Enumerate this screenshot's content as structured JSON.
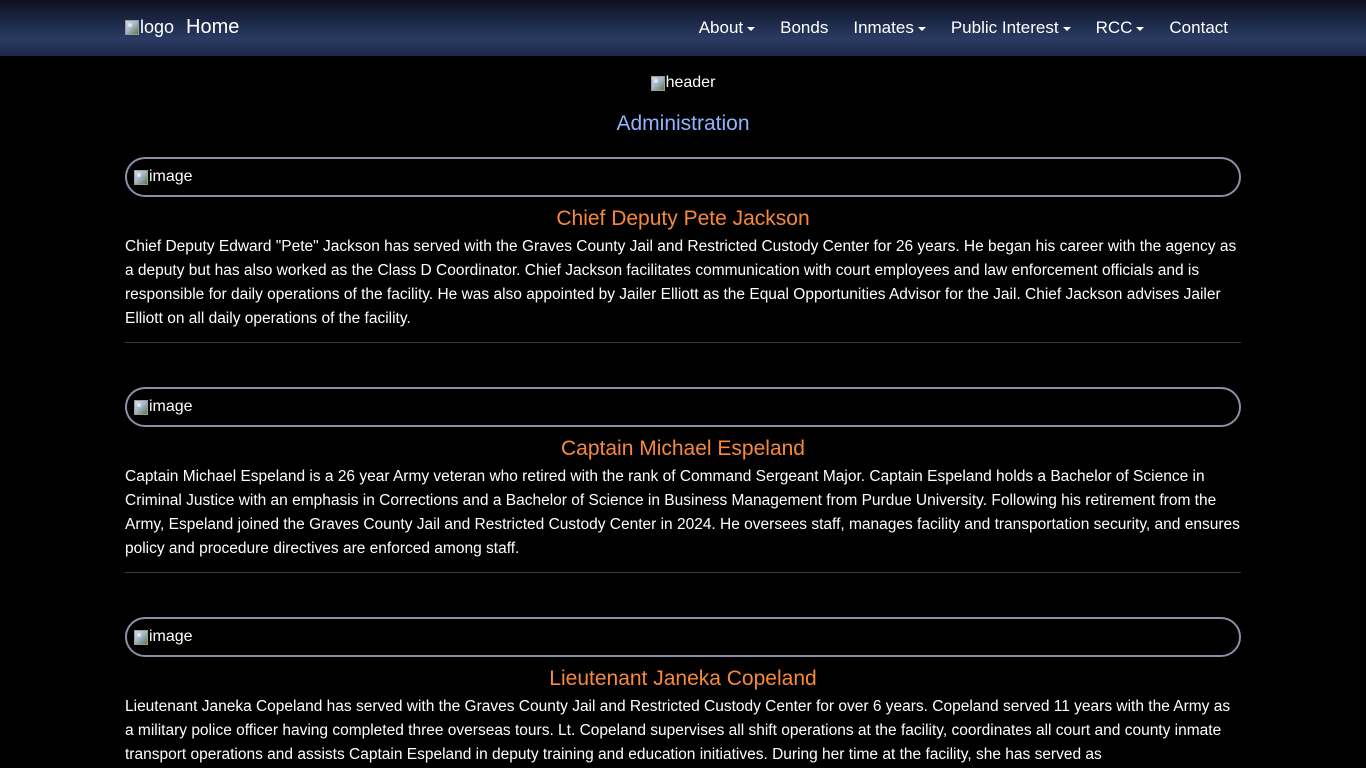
{
  "navbar": {
    "logo_alt": "logo",
    "home_label": "Home",
    "items": [
      {
        "label": "About",
        "dropdown": true
      },
      {
        "label": "Bonds",
        "dropdown": false
      },
      {
        "label": "Inmates",
        "dropdown": true
      },
      {
        "label": "Public Interest",
        "dropdown": true
      },
      {
        "label": "RCC",
        "dropdown": true
      },
      {
        "label": "Contact",
        "dropdown": false
      }
    ]
  },
  "header": {
    "image_alt": "header",
    "title": "Administration"
  },
  "staff": [
    {
      "image_alt": "image",
      "name": "Chief Deputy Pete Jackson",
      "bio": "Chief Deputy Edward \"Pete\" Jackson has served with the Graves County Jail and Restricted Custody Center for 26 years. He began his career with the agency as a deputy but has also worked as the Class D Coordinator. Chief Jackson facilitates communication with court employees and law enforcement officials and is responsible for daily operations of the facility. He was also appointed by Jailer Elliott as the Equal Opportunities Advisor for the Jail. Chief Jackson advises Jailer Elliott on all daily operations of the facility."
    },
    {
      "image_alt": "image",
      "name": "Captain Michael Espeland",
      "bio": "Captain Michael Espeland is a 26 year Army veteran who retired with the rank of Command Sergeant Major. Captain Espeland holds a Bachelor of Science in Criminal Justice with an emphasis in Corrections and a Bachelor of Science in Business Management from Purdue University. Following his retirement from the Army, Espeland joined the Graves County Jail and Restricted Custody Center in 2024. He oversees staff, manages facility and transportation security, and ensures policy and procedure directives are enforced among staff."
    },
    {
      "image_alt": "image",
      "name": "Lieutenant Janeka Copeland",
      "bio": "Lieutenant Janeka Copeland has served with the Graves County Jail and Restricted Custody Center for over 6 years. Copeland served 11 years with the Army as a military police officer having completed three overseas tours. Lt. Copeland supervises all shift operations at the facility, coordinates all court and county inmate transport operations and assists Captain Espeland in deputy training and education initiatives. During her time at the facility, she has served as"
    }
  ],
  "colors": {
    "background": "#000000",
    "section_title": "#8fb4ff",
    "person_name": "#f7893b",
    "image_frame_border": "#8a8fa6"
  }
}
